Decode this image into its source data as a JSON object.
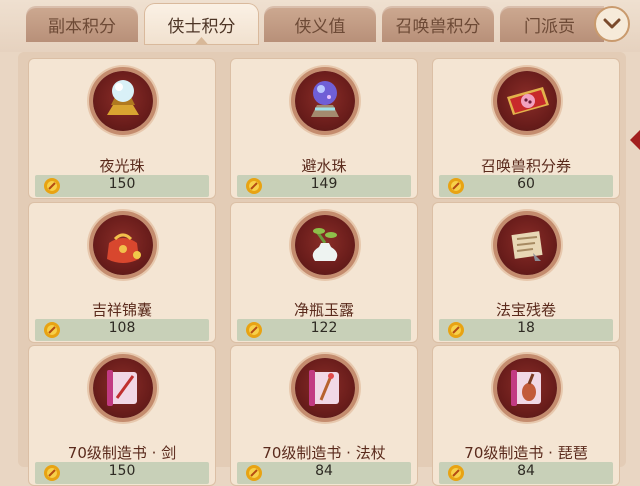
{
  "tabs": [
    {
      "label": "副本积分",
      "active": false
    },
    {
      "label": "侠士积分",
      "active": true
    },
    {
      "label": "侠义值",
      "active": false
    },
    {
      "label": "召唤兽积分",
      "active": false
    },
    {
      "label": "门派贡",
      "active": false
    }
  ],
  "collapse_icon": "chevron-down-icon",
  "items": [
    {
      "name": "夜光珠",
      "price": "150",
      "icon": "pearl-icon"
    },
    {
      "name": "避水珠",
      "price": "149",
      "icon": "water-orb-icon"
    },
    {
      "name": "召唤兽积分券",
      "price": "60",
      "icon": "ticket-icon"
    },
    {
      "name": "吉祥锦囊",
      "price": "108",
      "icon": "pouch-icon"
    },
    {
      "name": "净瓶玉露",
      "price": "122",
      "icon": "vase-icon"
    },
    {
      "name": "法宝残卷",
      "price": "18",
      "icon": "scroll-fragment-icon"
    },
    {
      "name": "70级制造书 · 剑",
      "price": "150",
      "icon": "book-sword-icon"
    },
    {
      "name": "70级制造书 · 法杖",
      "price": "84",
      "icon": "book-staff-icon"
    },
    {
      "name": "70级制造书 · 琵琶",
      "price": "84",
      "icon": "book-pipa-icon"
    }
  ],
  "colors": {
    "accent": "#c8d0b8",
    "card": "#f4e5d3",
    "coin": "#e8a313"
  }
}
